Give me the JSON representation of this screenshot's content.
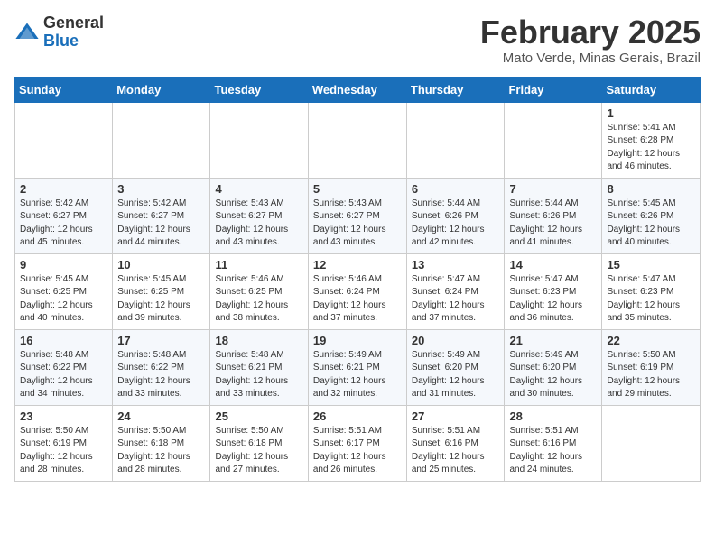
{
  "header": {
    "logo_general": "General",
    "logo_blue": "Blue",
    "month_title": "February 2025",
    "location": "Mato Verde, Minas Gerais, Brazil"
  },
  "days_of_week": [
    "Sunday",
    "Monday",
    "Tuesday",
    "Wednesday",
    "Thursday",
    "Friday",
    "Saturday"
  ],
  "weeks": [
    [
      {
        "day": "",
        "info": ""
      },
      {
        "day": "",
        "info": ""
      },
      {
        "day": "",
        "info": ""
      },
      {
        "day": "",
        "info": ""
      },
      {
        "day": "",
        "info": ""
      },
      {
        "day": "",
        "info": ""
      },
      {
        "day": "1",
        "info": "Sunrise: 5:41 AM\nSunset: 6:28 PM\nDaylight: 12 hours\nand 46 minutes."
      }
    ],
    [
      {
        "day": "2",
        "info": "Sunrise: 5:42 AM\nSunset: 6:27 PM\nDaylight: 12 hours\nand 45 minutes."
      },
      {
        "day": "3",
        "info": "Sunrise: 5:42 AM\nSunset: 6:27 PM\nDaylight: 12 hours\nand 44 minutes."
      },
      {
        "day": "4",
        "info": "Sunrise: 5:43 AM\nSunset: 6:27 PM\nDaylight: 12 hours\nand 43 minutes."
      },
      {
        "day": "5",
        "info": "Sunrise: 5:43 AM\nSunset: 6:27 PM\nDaylight: 12 hours\nand 43 minutes."
      },
      {
        "day": "6",
        "info": "Sunrise: 5:44 AM\nSunset: 6:26 PM\nDaylight: 12 hours\nand 42 minutes."
      },
      {
        "day": "7",
        "info": "Sunrise: 5:44 AM\nSunset: 6:26 PM\nDaylight: 12 hours\nand 41 minutes."
      },
      {
        "day": "8",
        "info": "Sunrise: 5:45 AM\nSunset: 6:26 PM\nDaylight: 12 hours\nand 40 minutes."
      }
    ],
    [
      {
        "day": "9",
        "info": "Sunrise: 5:45 AM\nSunset: 6:25 PM\nDaylight: 12 hours\nand 40 minutes."
      },
      {
        "day": "10",
        "info": "Sunrise: 5:45 AM\nSunset: 6:25 PM\nDaylight: 12 hours\nand 39 minutes."
      },
      {
        "day": "11",
        "info": "Sunrise: 5:46 AM\nSunset: 6:25 PM\nDaylight: 12 hours\nand 38 minutes."
      },
      {
        "day": "12",
        "info": "Sunrise: 5:46 AM\nSunset: 6:24 PM\nDaylight: 12 hours\nand 37 minutes."
      },
      {
        "day": "13",
        "info": "Sunrise: 5:47 AM\nSunset: 6:24 PM\nDaylight: 12 hours\nand 37 minutes."
      },
      {
        "day": "14",
        "info": "Sunrise: 5:47 AM\nSunset: 6:23 PM\nDaylight: 12 hours\nand 36 minutes."
      },
      {
        "day": "15",
        "info": "Sunrise: 5:47 AM\nSunset: 6:23 PM\nDaylight: 12 hours\nand 35 minutes."
      }
    ],
    [
      {
        "day": "16",
        "info": "Sunrise: 5:48 AM\nSunset: 6:22 PM\nDaylight: 12 hours\nand 34 minutes."
      },
      {
        "day": "17",
        "info": "Sunrise: 5:48 AM\nSunset: 6:22 PM\nDaylight: 12 hours\nand 33 minutes."
      },
      {
        "day": "18",
        "info": "Sunrise: 5:48 AM\nSunset: 6:21 PM\nDaylight: 12 hours\nand 33 minutes."
      },
      {
        "day": "19",
        "info": "Sunrise: 5:49 AM\nSunset: 6:21 PM\nDaylight: 12 hours\nand 32 minutes."
      },
      {
        "day": "20",
        "info": "Sunrise: 5:49 AM\nSunset: 6:20 PM\nDaylight: 12 hours\nand 31 minutes."
      },
      {
        "day": "21",
        "info": "Sunrise: 5:49 AM\nSunset: 6:20 PM\nDaylight: 12 hours\nand 30 minutes."
      },
      {
        "day": "22",
        "info": "Sunrise: 5:50 AM\nSunset: 6:19 PM\nDaylight: 12 hours\nand 29 minutes."
      }
    ],
    [
      {
        "day": "23",
        "info": "Sunrise: 5:50 AM\nSunset: 6:19 PM\nDaylight: 12 hours\nand 28 minutes."
      },
      {
        "day": "24",
        "info": "Sunrise: 5:50 AM\nSunset: 6:18 PM\nDaylight: 12 hours\nand 28 minutes."
      },
      {
        "day": "25",
        "info": "Sunrise: 5:50 AM\nSunset: 6:18 PM\nDaylight: 12 hours\nand 27 minutes."
      },
      {
        "day": "26",
        "info": "Sunrise: 5:51 AM\nSunset: 6:17 PM\nDaylight: 12 hours\nand 26 minutes."
      },
      {
        "day": "27",
        "info": "Sunrise: 5:51 AM\nSunset: 6:16 PM\nDaylight: 12 hours\nand 25 minutes."
      },
      {
        "day": "28",
        "info": "Sunrise: 5:51 AM\nSunset: 6:16 PM\nDaylight: 12 hours\nand 24 minutes."
      },
      {
        "day": "",
        "info": ""
      }
    ]
  ]
}
